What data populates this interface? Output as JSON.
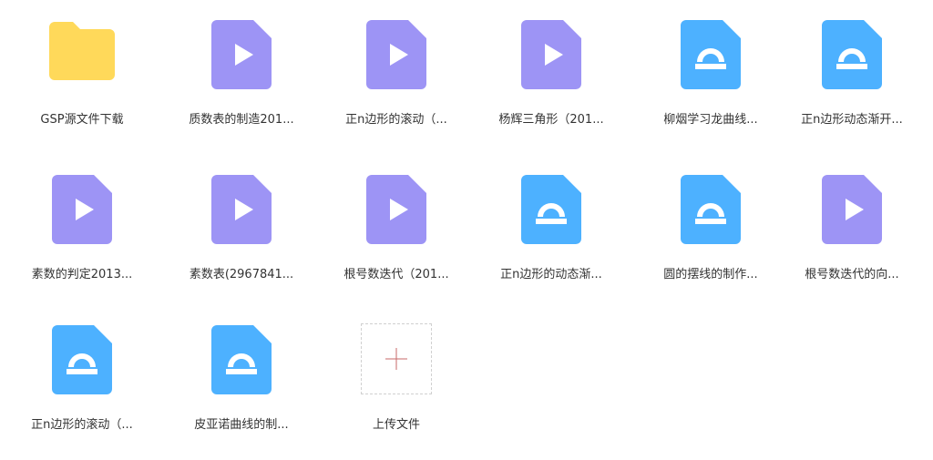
{
  "colors": {
    "folder": "#ffd95a",
    "video": "#9d94f5",
    "video_icon": "#ffffff",
    "gsp": "#4db1ff",
    "gsp_icon": "#ffffff",
    "text": "#333333",
    "upload_border": "#d0d0d0",
    "upload_plus": "#c76a6a"
  },
  "files": [
    {
      "label": "GSP源文件下载",
      "icon": "folder-icon"
    },
    {
      "label": "质数表的制造201...",
      "icon": "video-file-icon"
    },
    {
      "label": "正n边形的滚动（...",
      "icon": "video-file-icon"
    },
    {
      "label": "杨辉三角形（201...",
      "icon": "video-file-icon"
    },
    {
      "label": "柳烟学习龙曲线...",
      "icon": "gsp-file-icon"
    },
    {
      "label": "正n边形动态渐开...",
      "icon": "gsp-file-icon"
    },
    {
      "label": "素数的判定2013...",
      "icon": "video-file-icon"
    },
    {
      "label": "素数表(2967841...",
      "icon": "video-file-icon"
    },
    {
      "label": "根号数迭代（201...",
      "icon": "video-file-icon"
    },
    {
      "label": "正n边形的动态渐...",
      "icon": "gsp-file-icon"
    },
    {
      "label": "圆的摆线的制作...",
      "icon": "gsp-file-icon"
    },
    {
      "label": "根号数迭代的向...",
      "icon": "video-file-icon"
    },
    {
      "label": "正n边形的滚动（...",
      "icon": "gsp-file-icon"
    },
    {
      "label": "皮亚诺曲线的制...",
      "icon": "gsp-file-icon"
    }
  ],
  "upload": {
    "label": "上传文件",
    "icon": "plus-icon"
  }
}
